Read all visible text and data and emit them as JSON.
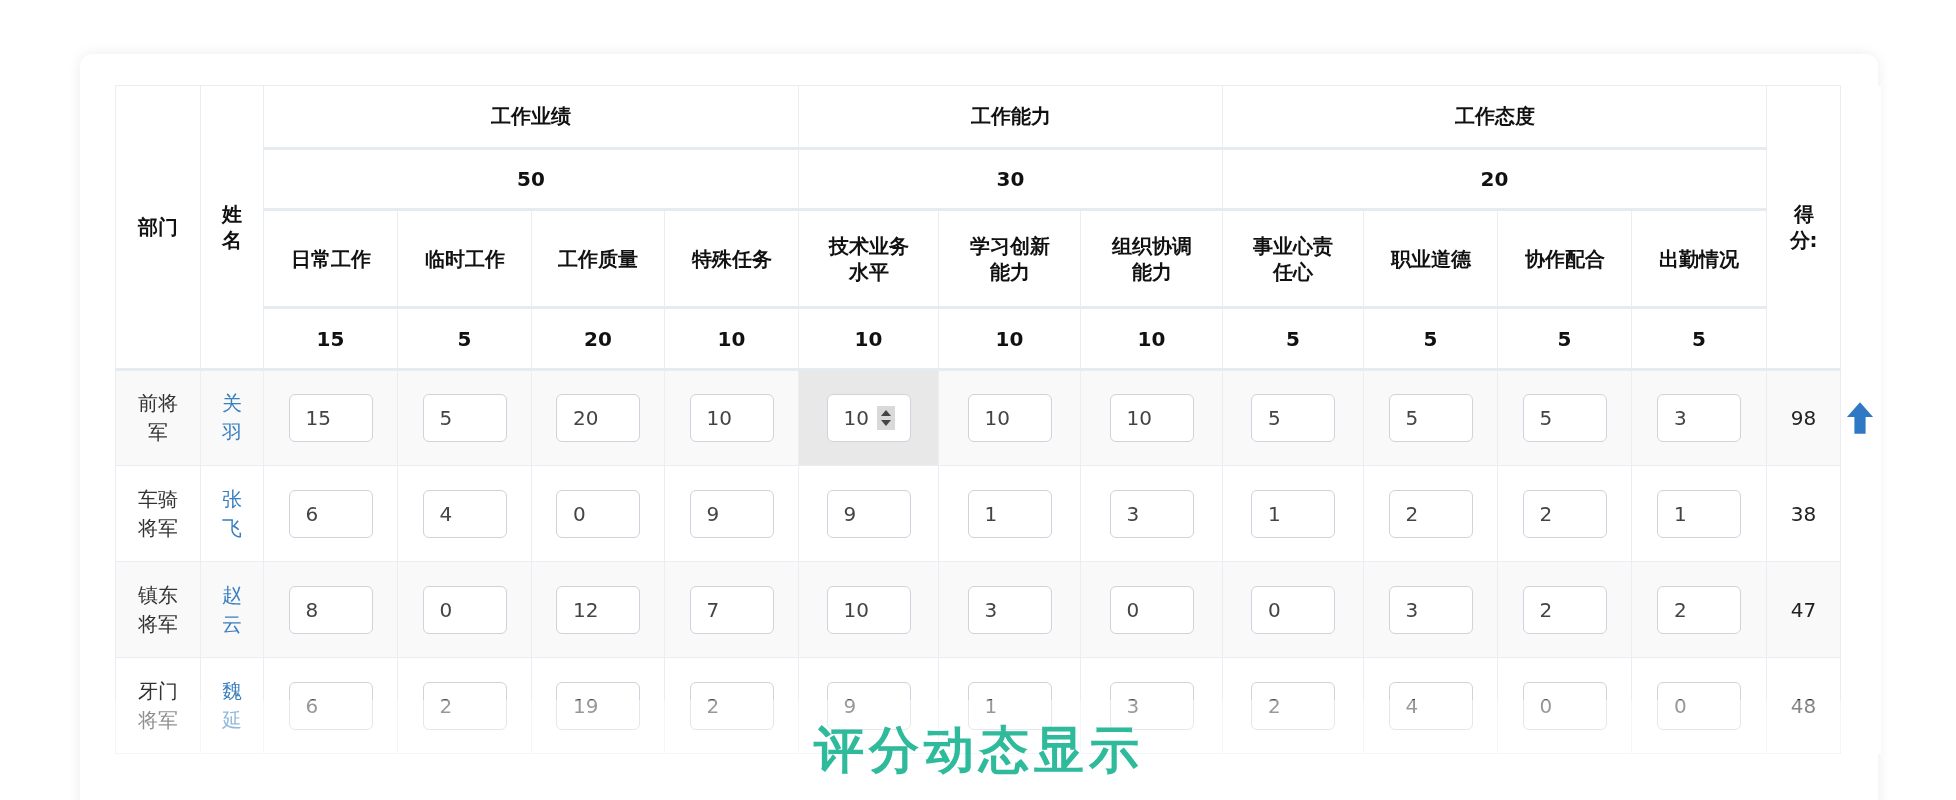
{
  "table": {
    "columns": {
      "department": "部门",
      "name": "姓名",
      "score": "得分:"
    },
    "groups": [
      {
        "label": "工作业绩",
        "weight": "50",
        "criteria": [
          {
            "label": "日常工作",
            "max": "15"
          },
          {
            "label": "临时工作",
            "max": "5"
          },
          {
            "label": "工作质量",
            "max": "20"
          },
          {
            "label": "特殊任务",
            "max": "10"
          }
        ]
      },
      {
        "label": "工作能力",
        "weight": "30",
        "criteria": [
          {
            "label": "技术业务水平",
            "max": "10"
          },
          {
            "label": "学习创新能力",
            "max": "10"
          },
          {
            "label": "组织协调能力",
            "max": "10"
          }
        ]
      },
      {
        "label": "工作态度",
        "weight": "20",
        "criteria": [
          {
            "label": "事业心责任心",
            "max": "5"
          },
          {
            "label": "职业道德",
            "max": "5"
          },
          {
            "label": "协作配合",
            "max": "5"
          },
          {
            "label": "出勤情况",
            "max": "5"
          }
        ]
      }
    ],
    "rows": [
      {
        "department": "前将军",
        "name": "关羽",
        "scores": [
          {
            "value": "15",
            "hovered": false
          },
          {
            "value": "5",
            "hovered": false
          },
          {
            "value": "20",
            "hovered": false
          },
          {
            "value": "10",
            "hovered": false
          },
          {
            "value": "10",
            "hovered": true
          },
          {
            "value": "10",
            "hovered": false
          },
          {
            "value": "10",
            "hovered": false
          },
          {
            "value": "5",
            "hovered": false
          },
          {
            "value": "5",
            "hovered": false
          },
          {
            "value": "5",
            "hovered": false
          },
          {
            "value": "3",
            "hovered": false
          }
        ],
        "total": "98",
        "rising": true
      },
      {
        "department": "车骑将军",
        "name": "张飞",
        "scores": [
          {
            "value": "6",
            "hovered": false
          },
          {
            "value": "4",
            "hovered": false
          },
          {
            "value": "0",
            "hovered": false
          },
          {
            "value": "9",
            "hovered": false
          },
          {
            "value": "9",
            "hovered": false
          },
          {
            "value": "1",
            "hovered": false
          },
          {
            "value": "3",
            "hovered": false
          },
          {
            "value": "1",
            "hovered": false
          },
          {
            "value": "2",
            "hovered": false
          },
          {
            "value": "2",
            "hovered": false
          },
          {
            "value": "1",
            "hovered": false
          }
        ],
        "total": "38",
        "rising": false
      },
      {
        "department": "镇东将军",
        "name": "赵云",
        "scores": [
          {
            "value": "8",
            "hovered": false
          },
          {
            "value": "0",
            "hovered": false
          },
          {
            "value": "12",
            "hovered": false
          },
          {
            "value": "7",
            "hovered": false
          },
          {
            "value": "10",
            "hovered": false
          },
          {
            "value": "3",
            "hovered": false
          },
          {
            "value": "0",
            "hovered": false
          },
          {
            "value": "0",
            "hovered": false
          },
          {
            "value": "3",
            "hovered": false
          },
          {
            "value": "2",
            "hovered": false
          },
          {
            "value": "2",
            "hovered": false
          }
        ],
        "total": "47",
        "rising": false
      },
      {
        "department": "牙门将军",
        "name": "魏延",
        "scores": [
          {
            "value": "6",
            "hovered": false
          },
          {
            "value": "2",
            "hovered": false
          },
          {
            "value": "19",
            "hovered": false
          },
          {
            "value": "2",
            "hovered": false
          },
          {
            "value": "9",
            "hovered": false
          },
          {
            "value": "1",
            "hovered": false
          },
          {
            "value": "3",
            "hovered": false
          },
          {
            "value": "2",
            "hovered": false
          },
          {
            "value": "4",
            "hovered": false
          },
          {
            "value": "0",
            "hovered": false
          },
          {
            "value": "0",
            "hovered": false
          }
        ],
        "total": "48",
        "rising": false
      }
    ]
  },
  "caption": "评分动态显示"
}
